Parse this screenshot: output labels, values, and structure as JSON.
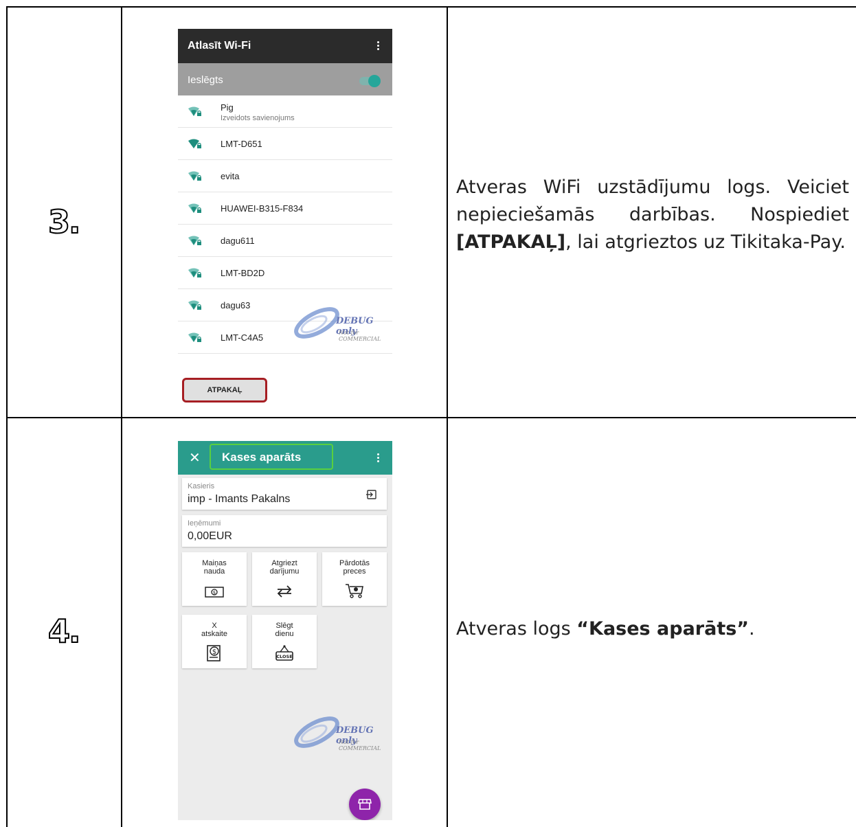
{
  "steps": [
    {
      "number": "3.",
      "description_parts": [
        "Atveras WiFi uzstādījumu logs. Veiciet nepieciešamās darbības. Nospiediet ",
        "[ATPAKAĻ]",
        ", lai atgrieztos uz Tikitaka-Pay."
      ],
      "screen": {
        "title": "Atlasīt Wi-Fi",
        "toggle_label": "Ieslēgts",
        "networks": [
          {
            "name": "Pig",
            "status": "Izveidots savienojums"
          },
          {
            "name": "LMT-D651"
          },
          {
            "name": "evita"
          },
          {
            "name": "HUAWEI-B315-F834"
          },
          {
            "name": "dagu611"
          },
          {
            "name": "LMT-BD2D"
          },
          {
            "name": "dagu63"
          },
          {
            "name": "LMT-C4A5"
          }
        ],
        "back_button": "ATPAKAĻ",
        "watermark": {
          "line1": "DEBUG only",
          "line2": "Not for COMMERCIAL"
        }
      }
    },
    {
      "number": "4.",
      "description_parts": [
        "Atveras logs ",
        "“Kases aparāts”",
        "."
      ],
      "screen": {
        "title": "Kases aparāts",
        "cashier": {
          "label": "Kasieris",
          "value": "imp - Imants Pakalns"
        },
        "revenue": {
          "label": "Ieņēmumi",
          "value": "0,00EUR"
        },
        "tiles": [
          {
            "label": "Maiņas nauda",
            "icon": "banknote-icon"
          },
          {
            "label": "Atgriezt darījumu",
            "icon": "return-arrows-icon"
          },
          {
            "label": "Pārdotās preces",
            "icon": "cart-icon"
          },
          {
            "label": "X atskaite",
            "icon": "dollar-receipt-icon"
          },
          {
            "label": "Slēgt dienu",
            "icon": "close-sign-icon"
          }
        ],
        "watermark": {
          "line1": "DEBUG only",
          "line2": "Not for COMMERCIAL"
        },
        "colors": {
          "appbar": "#2a9c8c",
          "fab": "#8e24aa",
          "highlight": "#59d03f"
        }
      }
    }
  ]
}
